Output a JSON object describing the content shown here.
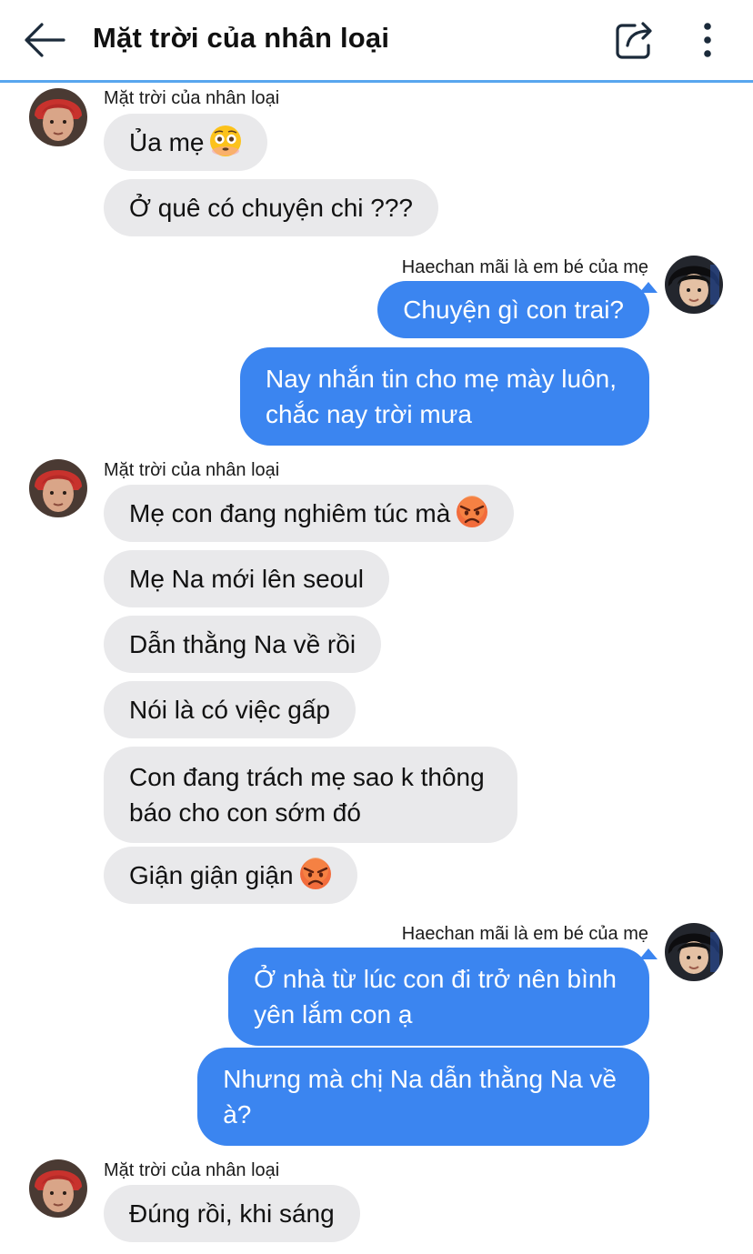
{
  "header": {
    "title": "Mặt trời của nhân loại"
  },
  "colors": {
    "outgoing_bubble": "#3b85f0",
    "incoming_bubble": "#e9e9eb",
    "header_divider": "#58a6ee"
  },
  "icons": {
    "back": "arrow-left-icon",
    "share": "share-icon",
    "more": "more-vertical-icon",
    "flushed_emoji": "flushed-face-emoji",
    "angry_emoji": "angry-face-emoji"
  },
  "groups": [
    {
      "sender": "Mặt trời của nhân loại",
      "direction": "incoming",
      "messages": [
        {
          "text": "Ủa mẹ",
          "emoji": "flushed-face-emoji"
        },
        {
          "text": "Ở quê có chuyện chi ???"
        }
      ]
    },
    {
      "sender": "Haechan mãi là em bé của mẹ",
      "direction": "outgoing",
      "messages": [
        {
          "text": "Chuyện gì con trai?"
        },
        {
          "lines": [
            "Nay nhắn tin cho mẹ mày luôn,",
            "chắc nay trời mưa"
          ]
        }
      ]
    },
    {
      "sender": "Mặt trời của nhân loại",
      "direction": "incoming",
      "messages": [
        {
          "text": "Mẹ con đang nghiêm túc mà",
          "emoji": "angry-face-emoji"
        },
        {
          "text": "Mẹ Na mới lên seoul"
        },
        {
          "text": "Dẫn thằng Na về rồi"
        },
        {
          "text": "Nói là có việc gấp"
        },
        {
          "lines": [
            "Con đang trách mẹ sao k thông",
            "báo cho con sớm đó"
          ]
        },
        {
          "text": "Giận giận giận",
          "emoji": "angry-face-emoji"
        }
      ]
    },
    {
      "sender": "Haechan mãi là em bé của mẹ",
      "direction": "outgoing",
      "messages": [
        {
          "lines": [
            "Ở nhà từ lúc con đi trở nên bình",
            "yên lắm con ạ"
          ]
        },
        {
          "lines": [
            "Nhưng mà chị Na dẫn thằng Na về",
            "à?"
          ]
        }
      ]
    },
    {
      "sender": "Mặt trời của nhân loại",
      "direction": "incoming",
      "messages": [
        {
          "text": "Đúng rồi, khi sáng"
        }
      ]
    }
  ]
}
